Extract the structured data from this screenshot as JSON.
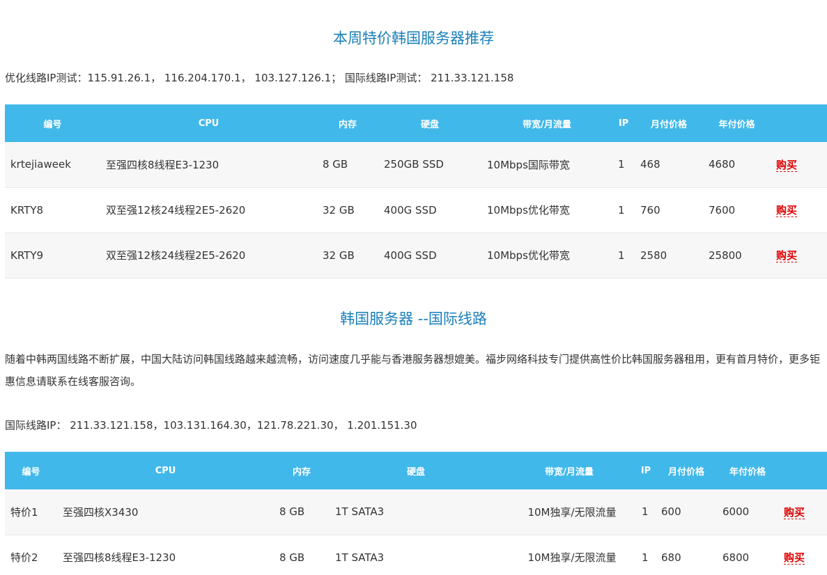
{
  "section1": {
    "title": "本周特价韩国服务器推荐",
    "ip_line": "优化线路IP测试：115.91.26.1， 116.204.170.1， 103.127.126.1； 国际线路IP测试： 211.33.121.158",
    "headers": [
      "编号",
      "CPU",
      "内存",
      "硬盘",
      "带宽/月流量",
      "IP",
      "月付价格",
      "年付价格",
      ""
    ],
    "rows": [
      {
        "id": "krtejiaweek",
        "cpu": "至强四核8线程E3-1230",
        "ram": "8 GB",
        "disk": "250GB SSD",
        "bw": "10Mbps国际带宽",
        "ip": "1",
        "monthly": "468",
        "yearly": "4680",
        "buy": "购买"
      },
      {
        "id": "KRTY8",
        "cpu": "双至强12核24线程2E5-2620",
        "ram": "32 GB",
        "disk": "400G SSD",
        "bw": "10Mbps优化带宽",
        "ip": "1",
        "monthly": "760",
        "yearly": "7600",
        "buy": "购买"
      },
      {
        "id": "KRTY9",
        "cpu": "双至强12核24线程2E5-2620",
        "ram": "32 GB",
        "disk": "400G SSD",
        "bw": "10Mbps优化带宽",
        "ip": "1",
        "monthly": "2580",
        "yearly": "25800",
        "buy": "购买"
      }
    ]
  },
  "section2": {
    "title": "韩国服务器 --国际线路",
    "paragraph": "随着中韩两国线路不断扩展，中国大陆访问韩国线路越来越流畅，访问速度几乎能与香港服务器想媲美。福步网络科技专门提供高性价比韩国服务器租用，更有首月特价，更多钜惠信息请联系在线客服咨询。",
    "ip_line": "国际线路IP： 211.33.121.158，103.131.164.30，121.78.221.30， 1.201.151.30",
    "headers": [
      "编号",
      "CPU",
      "内存",
      "硬盘",
      "带宽/月流量",
      "IP",
      "月付价格",
      "年付价格",
      ""
    ],
    "rows": [
      {
        "id": "特价1",
        "cpu": "至强四核X3430",
        "ram": "8 GB",
        "disk": "1T SATA3",
        "bw": "10M独享/无限流量",
        "ip": "1",
        "monthly": "600",
        "yearly": "6000",
        "buy": "购买"
      },
      {
        "id": "特价2",
        "cpu": "至强四核8线程E3-1230",
        "ram": "8 GB",
        "disk": "1T SATA3",
        "bw": "10M独享/无限流量",
        "ip": "1",
        "monthly": "680",
        "yearly": "6800",
        "buy": "购买"
      }
    ]
  },
  "colors": {
    "accent": "#1a7fb8",
    "header_bg": "#41b8ea",
    "buy": "#e00000"
  }
}
